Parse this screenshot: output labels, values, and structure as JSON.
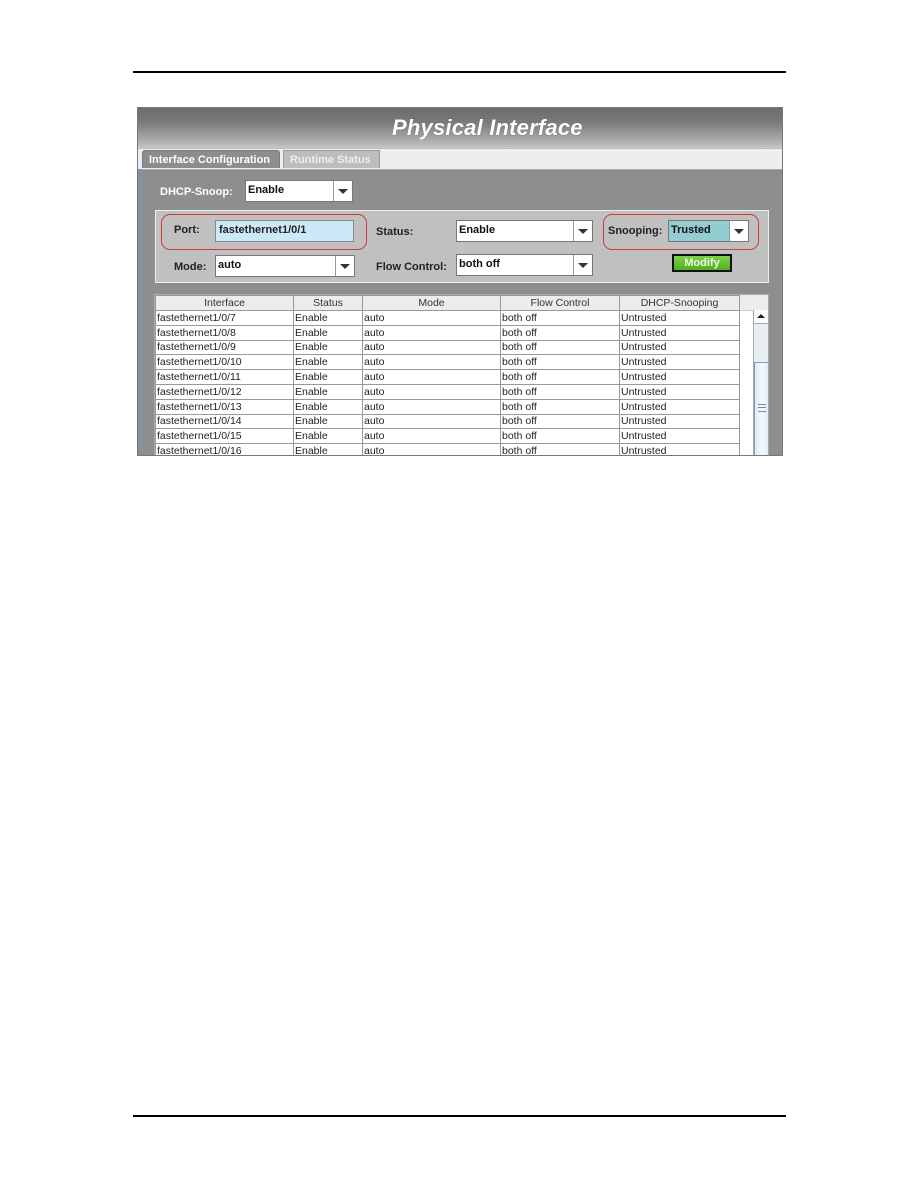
{
  "window": {
    "title": "Physical Interface"
  },
  "tabs": [
    {
      "label": "Interface Configuration",
      "active": true
    },
    {
      "label": "Runtime Status",
      "active": false
    }
  ],
  "dhcp_snoop": {
    "label": "DHCP-Snoop:",
    "value": "Enable"
  },
  "form": {
    "port": {
      "label": "Port:",
      "value": "fastethernet1/0/1"
    },
    "status": {
      "label": "Status:",
      "value": "Enable"
    },
    "snooping": {
      "label": "Snooping:",
      "value": "Trusted"
    },
    "mode": {
      "label": "Mode:",
      "value": "auto"
    },
    "flow_control": {
      "label": "Flow Control:",
      "value": "both off"
    },
    "modify_label": "Modify"
  },
  "colors": {
    "highlight_outline": "#d23b3b",
    "port_field_bg": "#cde8f7",
    "snooping_field_bg": "#93ccd1",
    "modify_button": "#5cbf2a"
  },
  "table": {
    "columns": [
      "Interface",
      "Status",
      "Mode",
      "Flow Control",
      "DHCP-Snooping"
    ],
    "rows": [
      [
        "fastethernet1/0/7",
        "Enable",
        "auto",
        "both off",
        "Untrusted"
      ],
      [
        "fastethernet1/0/8",
        "Enable",
        "auto",
        "both off",
        "Untrusted"
      ],
      [
        "fastethernet1/0/9",
        "Enable",
        "auto",
        "both off",
        "Untrusted"
      ],
      [
        "fastethernet1/0/10",
        "Enable",
        "auto",
        "both off",
        "Untrusted"
      ],
      [
        "fastethernet1/0/11",
        "Enable",
        "auto",
        "both off",
        "Untrusted"
      ],
      [
        "fastethernet1/0/12",
        "Enable",
        "auto",
        "both off",
        "Untrusted"
      ],
      [
        "fastethernet1/0/13",
        "Enable",
        "auto",
        "both off",
        "Untrusted"
      ],
      [
        "fastethernet1/0/14",
        "Enable",
        "auto",
        "both off",
        "Untrusted"
      ],
      [
        "fastethernet1/0/15",
        "Enable",
        "auto",
        "both off",
        "Untrusted"
      ],
      [
        "fastethernet1/0/16",
        "Enable",
        "auto",
        "both off",
        "Untrusted"
      ]
    ]
  }
}
